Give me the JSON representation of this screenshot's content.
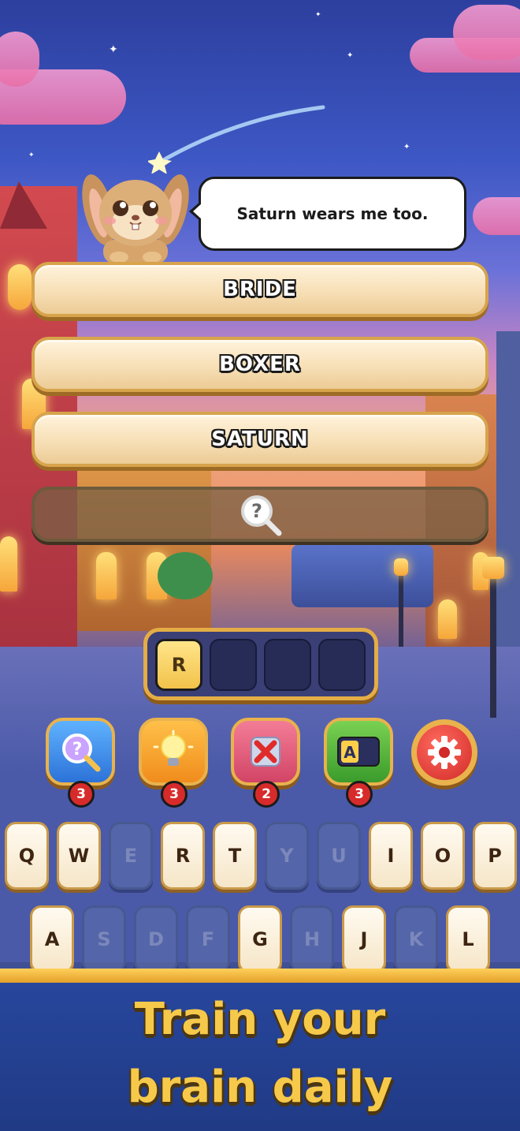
{
  "clue": {
    "text": "Saturn wears me too."
  },
  "answers": [
    {
      "word": "BRIDE"
    },
    {
      "word": "BOXER"
    },
    {
      "word": "SATURN"
    },
    {
      "word": "",
      "icon": "magnifier-question-icon"
    }
  ],
  "guess": {
    "letters": [
      "R",
      "",
      "",
      ""
    ]
  },
  "powerups": [
    {
      "name": "search-hint",
      "icon": "magnifier-question-icon",
      "count": "3",
      "color": "#3b8de8"
    },
    {
      "name": "bulb-hint",
      "icon": "lightbulb-icon",
      "count": "3",
      "color": "#f7a528"
    },
    {
      "name": "remove-letters",
      "icon": "cross-icon",
      "count": "2",
      "color": "#e2607e"
    },
    {
      "name": "reveal-letter",
      "icon": "letter-a-icon",
      "count": "3",
      "color": "#4cae3a"
    }
  ],
  "settings": {
    "icon": "gear-icon",
    "color": "#e03a36"
  },
  "keyboard": {
    "row1": [
      {
        "k": "Q",
        "on": true
      },
      {
        "k": "W",
        "on": true
      },
      {
        "k": "E",
        "on": false
      },
      {
        "k": "R",
        "on": true
      },
      {
        "k": "T",
        "on": true
      },
      {
        "k": "Y",
        "on": false
      },
      {
        "k": "U",
        "on": false
      },
      {
        "k": "I",
        "on": true
      },
      {
        "k": "O",
        "on": true
      },
      {
        "k": "P",
        "on": true
      }
    ],
    "row2": [
      {
        "k": "A",
        "on": true
      },
      {
        "k": "S",
        "on": false
      },
      {
        "k": "D",
        "on": false
      },
      {
        "k": "F",
        "on": false
      },
      {
        "k": "G",
        "on": true
      },
      {
        "k": "H",
        "on": false
      },
      {
        "k": "J",
        "on": true
      },
      {
        "k": "K",
        "on": false
      },
      {
        "k": "L",
        "on": true
      }
    ]
  },
  "tagline": {
    "line1": "Train your",
    "line2": "brain daily"
  }
}
